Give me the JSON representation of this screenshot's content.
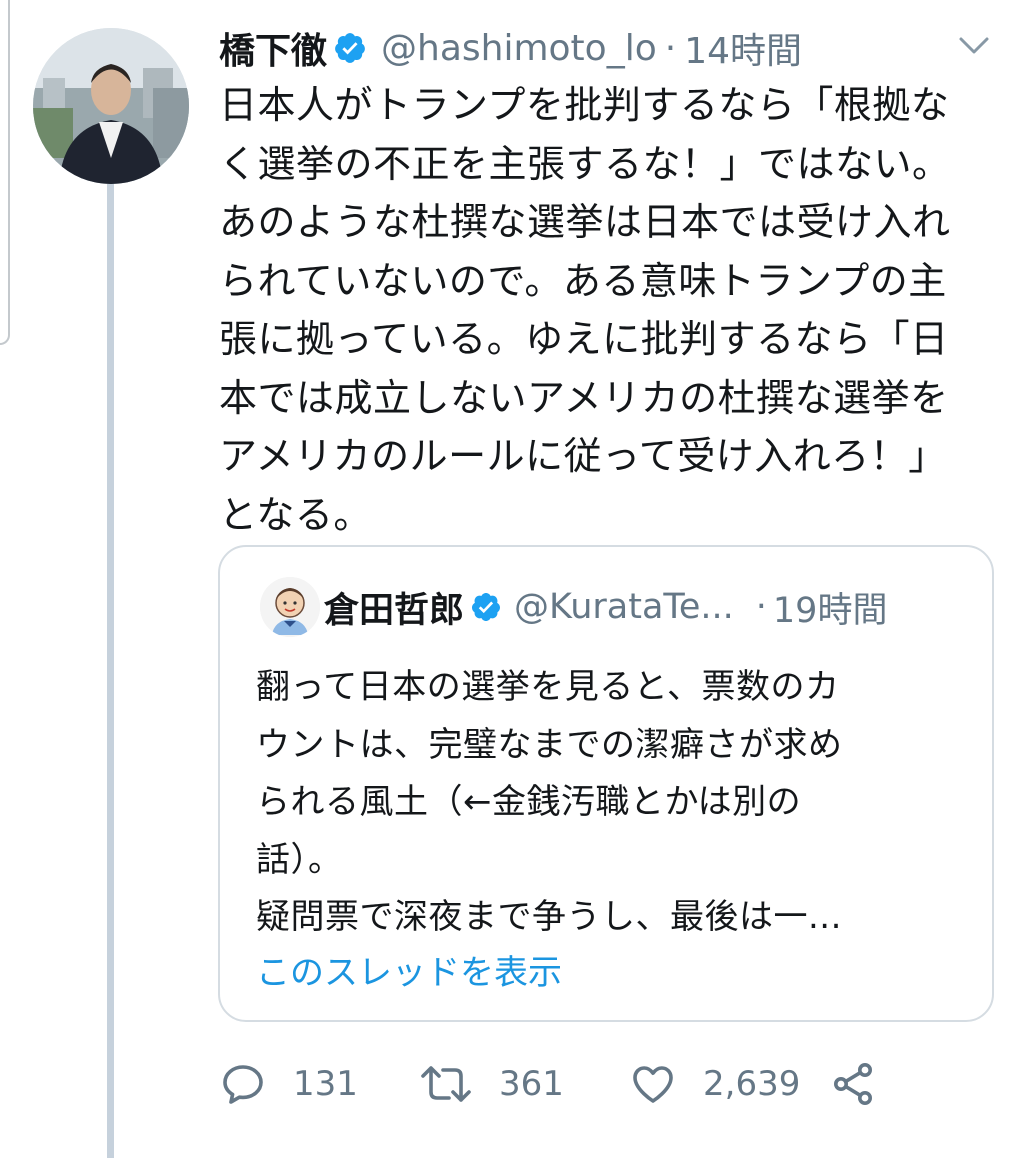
{
  "tweet": {
    "display_name": "橋下徹",
    "handle": "@hashimoto_lo",
    "separator": "·",
    "time": "14時間",
    "text_lines": [
      "日本人がトランプを批判するなら「根拠な",
      "く選挙の不正を主張するな！」ではない。",
      "あのような杜撰な選挙は日本では受け入れ",
      "られていないので。ある意味トランプの主",
      "張に拠っている。ゆえに批判するなら「日",
      "本では成立しないアメリカの杜撰な選挙を",
      "アメリカのルールに従って受け入れろ！」",
      "となる。"
    ]
  },
  "quoted_tweet": {
    "display_name": "倉田哲郎",
    "handle": "@KurataTe...",
    "separator": "·",
    "time": "19時間",
    "text_lines": [
      "翻って日本の選挙を見ると、票数のカ",
      "ウントは、完璧なまでの潔癖さが求め",
      "られる風土（←金銭汚職とかは別の",
      "話）。",
      "疑問票で深夜まで争うし、最後は一..."
    ],
    "show_thread_label": "このスレッドを表示"
  },
  "actions": {
    "replies": "131",
    "retweets": "361",
    "likes": "2,639"
  },
  "colors": {
    "text_primary": "#14171a",
    "text_secondary": "#657786",
    "link": "#1b95e0",
    "verified": "#1da1f2",
    "border": "#d5dce2",
    "thread_line": "#c6d1dc"
  },
  "icons": {
    "verified": "verified-badge-icon",
    "more": "chevron-down-icon",
    "reply": "reply-icon",
    "retweet": "retweet-icon",
    "like": "heart-icon",
    "share": "share-icon"
  }
}
